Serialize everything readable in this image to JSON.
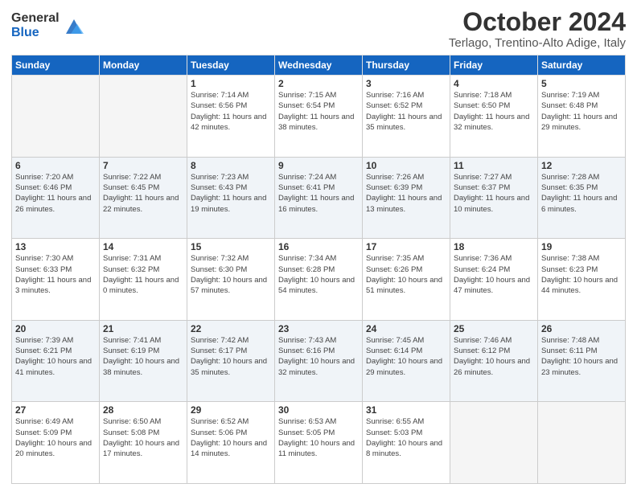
{
  "logo": {
    "general": "General",
    "blue": "Blue"
  },
  "title": "October 2024",
  "subtitle": "Terlago, Trentino-Alto Adige, Italy",
  "days_header": [
    "Sunday",
    "Monday",
    "Tuesday",
    "Wednesday",
    "Thursday",
    "Friday",
    "Saturday"
  ],
  "weeks": [
    [
      {
        "day": "",
        "info": ""
      },
      {
        "day": "",
        "info": ""
      },
      {
        "day": "1",
        "info": "Sunrise: 7:14 AM\nSunset: 6:56 PM\nDaylight: 11 hours and 42 minutes."
      },
      {
        "day": "2",
        "info": "Sunrise: 7:15 AM\nSunset: 6:54 PM\nDaylight: 11 hours and 38 minutes."
      },
      {
        "day": "3",
        "info": "Sunrise: 7:16 AM\nSunset: 6:52 PM\nDaylight: 11 hours and 35 minutes."
      },
      {
        "day": "4",
        "info": "Sunrise: 7:18 AM\nSunset: 6:50 PM\nDaylight: 11 hours and 32 minutes."
      },
      {
        "day": "5",
        "info": "Sunrise: 7:19 AM\nSunset: 6:48 PM\nDaylight: 11 hours and 29 minutes."
      }
    ],
    [
      {
        "day": "6",
        "info": "Sunrise: 7:20 AM\nSunset: 6:46 PM\nDaylight: 11 hours and 26 minutes."
      },
      {
        "day": "7",
        "info": "Sunrise: 7:22 AM\nSunset: 6:45 PM\nDaylight: 11 hours and 22 minutes."
      },
      {
        "day": "8",
        "info": "Sunrise: 7:23 AM\nSunset: 6:43 PM\nDaylight: 11 hours and 19 minutes."
      },
      {
        "day": "9",
        "info": "Sunrise: 7:24 AM\nSunset: 6:41 PM\nDaylight: 11 hours and 16 minutes."
      },
      {
        "day": "10",
        "info": "Sunrise: 7:26 AM\nSunset: 6:39 PM\nDaylight: 11 hours and 13 minutes."
      },
      {
        "day": "11",
        "info": "Sunrise: 7:27 AM\nSunset: 6:37 PM\nDaylight: 11 hours and 10 minutes."
      },
      {
        "day": "12",
        "info": "Sunrise: 7:28 AM\nSunset: 6:35 PM\nDaylight: 11 hours and 6 minutes."
      }
    ],
    [
      {
        "day": "13",
        "info": "Sunrise: 7:30 AM\nSunset: 6:33 PM\nDaylight: 11 hours and 3 minutes."
      },
      {
        "day": "14",
        "info": "Sunrise: 7:31 AM\nSunset: 6:32 PM\nDaylight: 11 hours and 0 minutes."
      },
      {
        "day": "15",
        "info": "Sunrise: 7:32 AM\nSunset: 6:30 PM\nDaylight: 10 hours and 57 minutes."
      },
      {
        "day": "16",
        "info": "Sunrise: 7:34 AM\nSunset: 6:28 PM\nDaylight: 10 hours and 54 minutes."
      },
      {
        "day": "17",
        "info": "Sunrise: 7:35 AM\nSunset: 6:26 PM\nDaylight: 10 hours and 51 minutes."
      },
      {
        "day": "18",
        "info": "Sunrise: 7:36 AM\nSunset: 6:24 PM\nDaylight: 10 hours and 47 minutes."
      },
      {
        "day": "19",
        "info": "Sunrise: 7:38 AM\nSunset: 6:23 PM\nDaylight: 10 hours and 44 minutes."
      }
    ],
    [
      {
        "day": "20",
        "info": "Sunrise: 7:39 AM\nSunset: 6:21 PM\nDaylight: 10 hours and 41 minutes."
      },
      {
        "day": "21",
        "info": "Sunrise: 7:41 AM\nSunset: 6:19 PM\nDaylight: 10 hours and 38 minutes."
      },
      {
        "day": "22",
        "info": "Sunrise: 7:42 AM\nSunset: 6:17 PM\nDaylight: 10 hours and 35 minutes."
      },
      {
        "day": "23",
        "info": "Sunrise: 7:43 AM\nSunset: 6:16 PM\nDaylight: 10 hours and 32 minutes."
      },
      {
        "day": "24",
        "info": "Sunrise: 7:45 AM\nSunset: 6:14 PM\nDaylight: 10 hours and 29 minutes."
      },
      {
        "day": "25",
        "info": "Sunrise: 7:46 AM\nSunset: 6:12 PM\nDaylight: 10 hours and 26 minutes."
      },
      {
        "day": "26",
        "info": "Sunrise: 7:48 AM\nSunset: 6:11 PM\nDaylight: 10 hours and 23 minutes."
      }
    ],
    [
      {
        "day": "27",
        "info": "Sunrise: 6:49 AM\nSunset: 5:09 PM\nDaylight: 10 hours and 20 minutes."
      },
      {
        "day": "28",
        "info": "Sunrise: 6:50 AM\nSunset: 5:08 PM\nDaylight: 10 hours and 17 minutes."
      },
      {
        "day": "29",
        "info": "Sunrise: 6:52 AM\nSunset: 5:06 PM\nDaylight: 10 hours and 14 minutes."
      },
      {
        "day": "30",
        "info": "Sunrise: 6:53 AM\nSunset: 5:05 PM\nDaylight: 10 hours and 11 minutes."
      },
      {
        "day": "31",
        "info": "Sunrise: 6:55 AM\nSunset: 5:03 PM\nDaylight: 10 hours and 8 minutes."
      },
      {
        "day": "",
        "info": ""
      },
      {
        "day": "",
        "info": ""
      }
    ]
  ]
}
